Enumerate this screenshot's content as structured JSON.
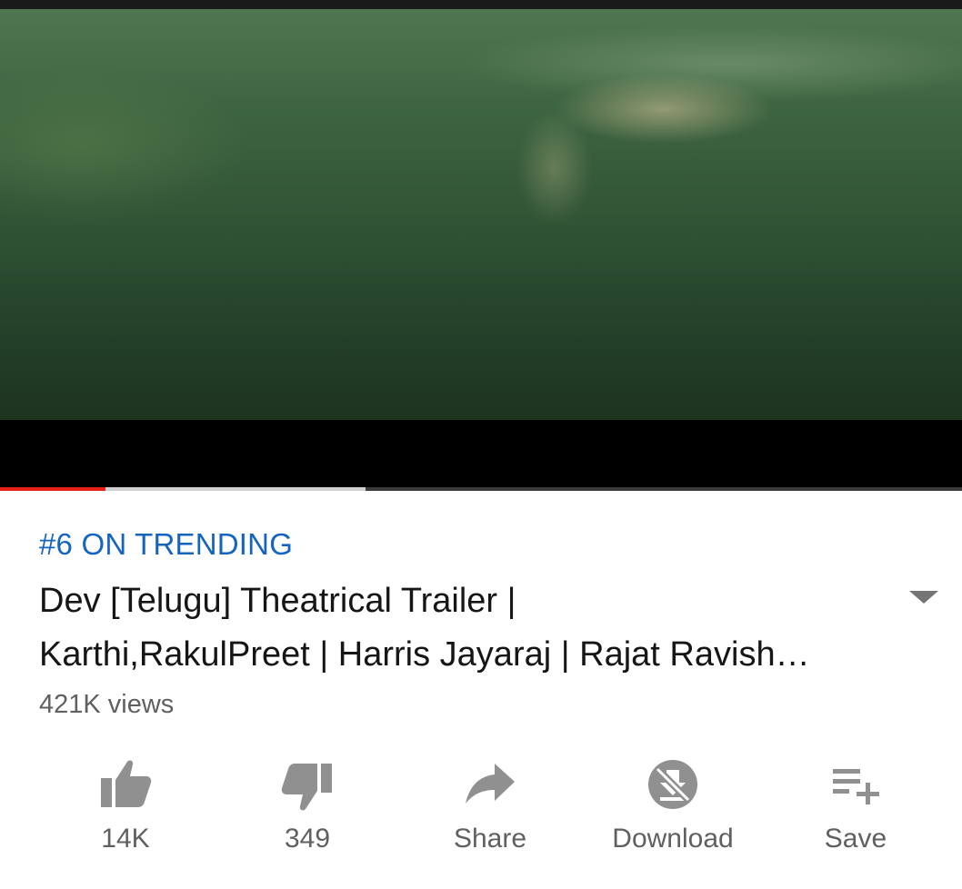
{
  "player": {
    "progress_played": 0.11,
    "progress_buffered": 0.38,
    "played_color": "#e62117"
  },
  "video": {
    "trending_badge": "#6 ON TRENDING",
    "title_line1": "Dev [Telugu]  Theatrical Trailer |",
    "title_line2": "Karthi,RakulPreet | Harris Jayaraj | Rajat Ravish…",
    "views": "421K views"
  },
  "actions": {
    "like": {
      "label": "14K",
      "icon": "thumbs-up-icon"
    },
    "dislike": {
      "label": "349",
      "icon": "thumbs-down-icon"
    },
    "share": {
      "label": "Share",
      "icon": "share-arrow-icon"
    },
    "download": {
      "label": "Download",
      "icon": "download-disabled-icon"
    },
    "save": {
      "label": "Save",
      "icon": "playlist-add-icon"
    }
  },
  "colors": {
    "accent_link": "#1565c0",
    "icon_gray": "#909090"
  }
}
